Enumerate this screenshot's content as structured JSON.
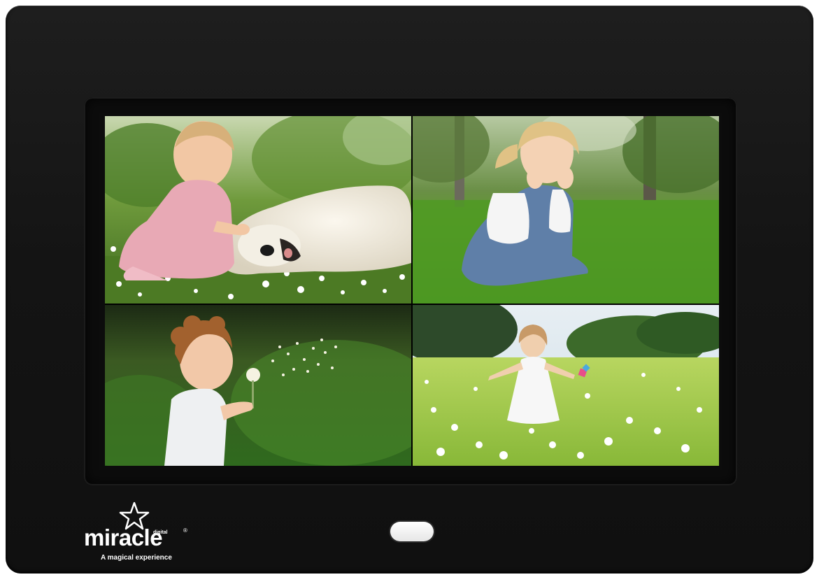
{
  "device": {
    "type": "digital photo frame",
    "frame_color": "#141414",
    "button_color": "#f2f2f2"
  },
  "screen": {
    "layout": "2x2 collage",
    "photos": [
      {
        "position": "top-left",
        "subject": "baby girl in pink dress lying in daisy meadow beside white dog"
      },
      {
        "position": "top-right",
        "subject": "toddler girl in denim dress crouching in grass with hands on cheeks"
      },
      {
        "position": "bottom-left",
        "subject": "curly-haired child blowing a dandelion"
      },
      {
        "position": "bottom-right",
        "subject": "girl in white dress running through a daisy field with pinwheel"
      }
    ]
  },
  "brand": {
    "name": "miracle",
    "sub_mark": "digital",
    "registered": "®",
    "tagline": "A magical experience",
    "logo_icon": "star-icon"
  }
}
